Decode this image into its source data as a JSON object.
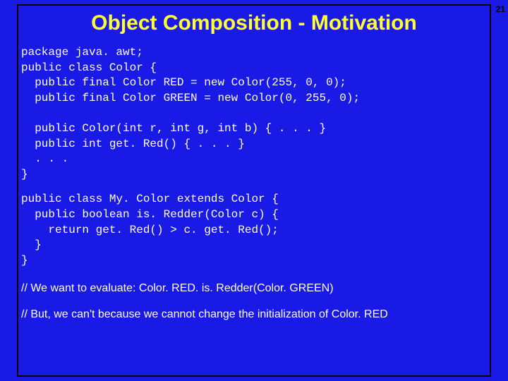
{
  "title": "Object Composition - Motivation",
  "slide_number": "21",
  "code_block1": "package java. awt;\npublic class Color {\n  public final Color RED = new Color(255, 0, 0);\n  public final Color GREEN = new Color(0, 255, 0);\n\n  public Color(int r, int g, int b) { . . . }\n  public int get. Red() { . . . }\n  . . .\n}",
  "code_block2": "public class My. Color extends Color {\n  public boolean is. Redder(Color c) {\n    return get. Red() > c. get. Red();\n  }\n}",
  "comment1": "// We want to evaluate: Color. RED. is. Redder(Color. GREEN)",
  "comment2": "// But, we can't because we cannot change the initialization of Color. RED"
}
